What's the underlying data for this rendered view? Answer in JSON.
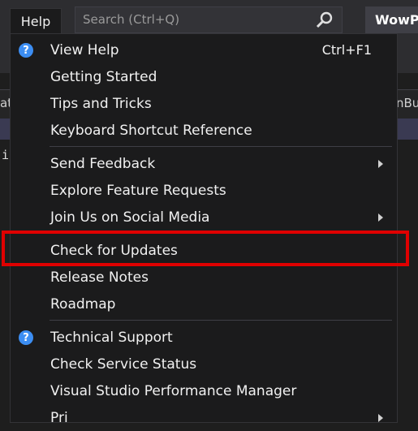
{
  "menubar": {
    "help_label": "Help"
  },
  "search": {
    "placeholder": "Search (Ctrl+Q)"
  },
  "app": {
    "title": "WowP"
  },
  "background": {
    "tab_left": "at",
    "tab_right": "nBu",
    "code_char": "i"
  },
  "menu": {
    "view_help": {
      "label": "View Help",
      "shortcut": "Ctrl+F1"
    },
    "getting_started": "Getting Started",
    "tips": "Tips and Tricks",
    "shortcut_ref": "Keyboard Shortcut Reference",
    "send_feedback": "Send Feedback",
    "explore_features": "Explore Feature Requests",
    "social": "Join Us on Social Media",
    "check_updates": "Check for Updates",
    "release_notes": "Release Notes",
    "roadmap": "Roadmap",
    "tech_support": "Technical Support",
    "service_status": "Check Service Status",
    "perf_manager": "Visual Studio Performance Manager",
    "next_partial": "Pri"
  },
  "colors": {
    "highlight": "#e00000",
    "help_icon": "#3c8ef3",
    "menu_bg": "#1b1b1c"
  }
}
